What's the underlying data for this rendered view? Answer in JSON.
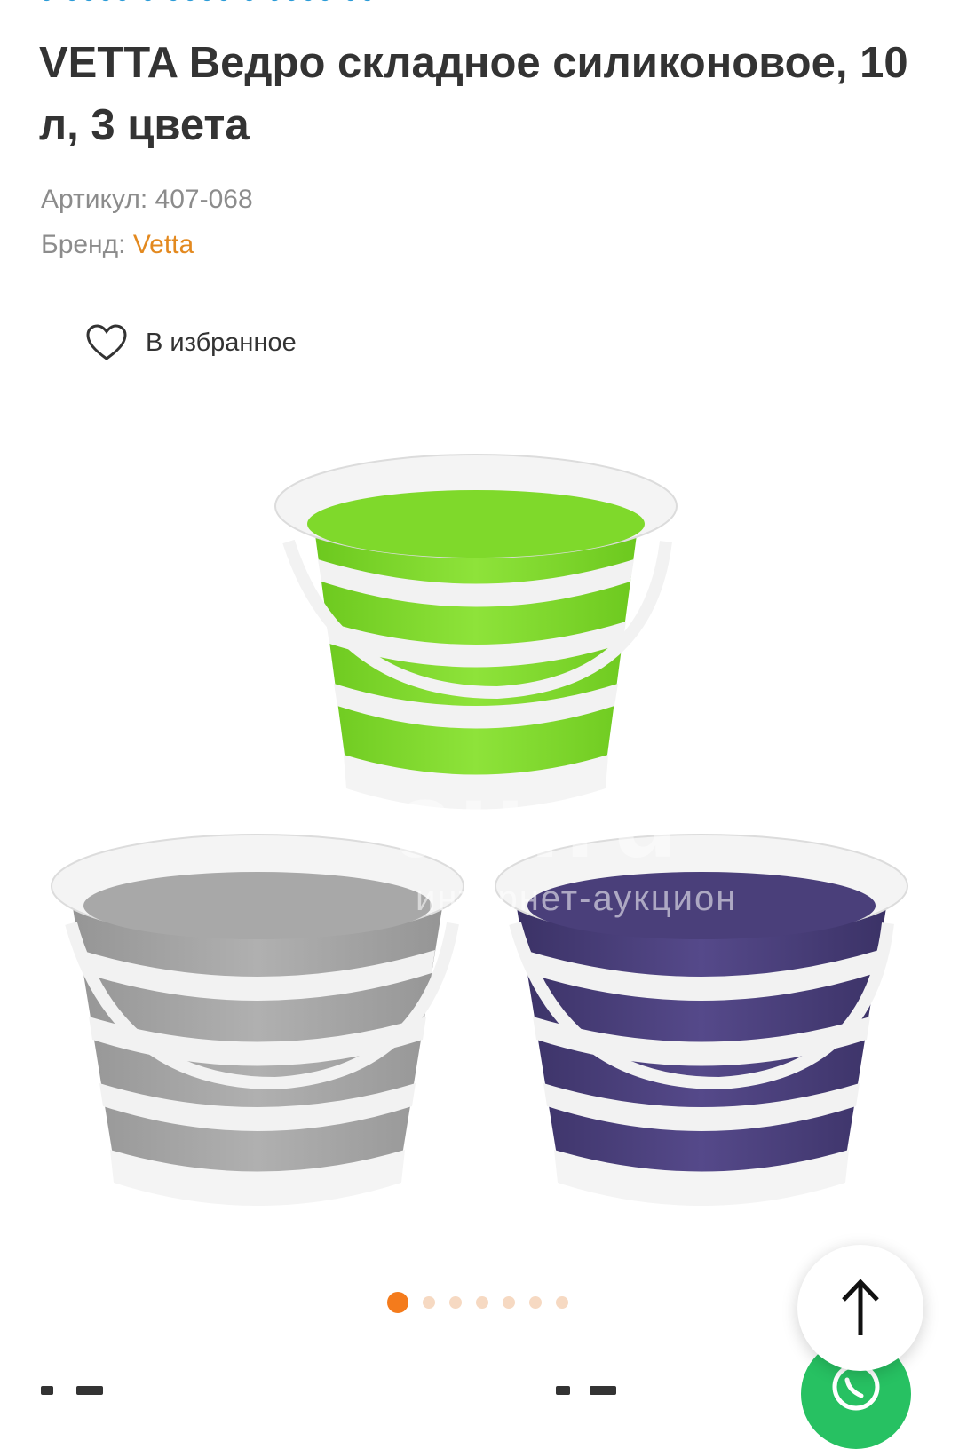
{
  "product": {
    "title": "VETTA Ведро складное силиконовое, 10 л, 3 цвета",
    "sku_label": "Артикул:",
    "sku_value": "407-068",
    "brand_label": "Бренд:",
    "brand_value": "Vetta"
  },
  "favorites": {
    "label": "В избранное",
    "icon": "heart-outline-icon"
  },
  "gallery": {
    "watermark_main": "au.ru",
    "watermark_sub": "интернет-аукцион",
    "bucket_colors": [
      "#7dd62a",
      "#a3a3a3",
      "#4a3f7a"
    ],
    "slide_count": 7,
    "active_slide": 1
  },
  "buttons": {
    "scroll_top_icon": "arrow-up-icon",
    "chat_icon": "whatsapp-icon"
  },
  "colors": {
    "accent": "#f47b1c",
    "brand_link": "#e3891f",
    "chat_green": "#27c162"
  }
}
